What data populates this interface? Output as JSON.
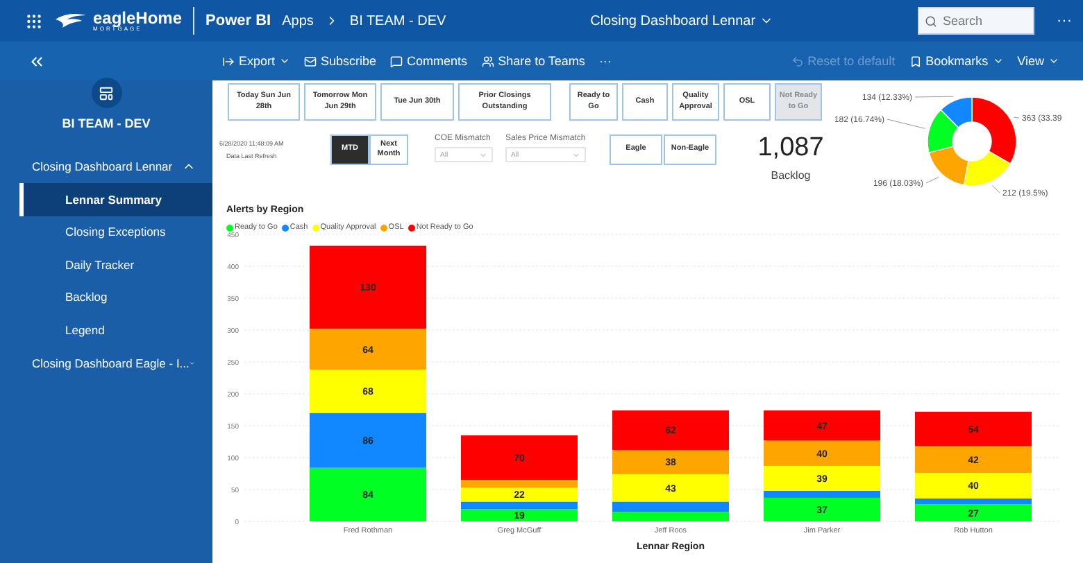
{
  "header": {
    "logo": {
      "name": "eagleHome",
      "tagline": "MORTGAGE"
    },
    "app_name": "Power BI",
    "breadcrumb": [
      "Apps",
      "BI TEAM - DEV"
    ],
    "report_title": "Closing Dashboard Lennar",
    "search": {
      "placeholder": "Search"
    },
    "more": "···"
  },
  "toolbar": {
    "actions": [
      {
        "label": "Export",
        "kind": "menu"
      },
      {
        "label": "Subscribe",
        "kind": "plain"
      },
      {
        "label": "Comments",
        "kind": "plain"
      },
      {
        "label": "Share to Teams",
        "kind": "plain"
      }
    ],
    "more": "···",
    "right": [
      {
        "label": "Reset to default",
        "kind": "plain",
        "disabled": true
      },
      {
        "label": "Bookmarks",
        "kind": "menu",
        "disabled": false
      },
      {
        "label": "View",
        "kind": "menu",
        "disabled": false
      }
    ]
  },
  "sidebar": {
    "workspace": "BI TEAM - DEV",
    "sections": [
      {
        "label": "Closing Dashboard Lennar",
        "expanded": true,
        "children": [
          {
            "label": "Lennar Summary",
            "selected": true
          },
          {
            "label": "Closing Exceptions",
            "selected": false
          },
          {
            "label": "Daily Tracker",
            "selected": false
          },
          {
            "label": "Backlog",
            "selected": false
          },
          {
            "label": "Legend",
            "selected": false
          }
        ]
      },
      {
        "label": "Closing Dashboard Eagle - I...",
        "expanded": false
      }
    ]
  },
  "filters": {
    "date_buttons": [
      {
        "label": "Today Sun Jun 28th",
        "selected": false
      },
      {
        "label": "Tomorrow Mon Jun 29th",
        "selected": false
      },
      {
        "label": "Tue Jun 30th",
        "selected": false
      },
      {
        "label": "Prior Closings Outstanding",
        "selected": false
      }
    ],
    "status_buttons": [
      {
        "label": "Ready to Go",
        "selected": false
      },
      {
        "label": "Cash",
        "selected": false
      },
      {
        "label": "Quality Approval",
        "selected": false
      },
      {
        "label": "OSL",
        "selected": false
      },
      {
        "label": "Not Ready to Go",
        "selected": true
      }
    ],
    "refresh": {
      "timestamp": "6/28/2020 11:48:09 AM",
      "label": "Data Last Refresh"
    },
    "period_buttons": [
      {
        "label": "MTD",
        "selected": true
      },
      {
        "label": "Next Month",
        "selected": false
      }
    ],
    "dropdowns": [
      {
        "label": "COE Mismatch",
        "value": "All"
      },
      {
        "label": "Sales Price Mismatch",
        "value": "All"
      }
    ],
    "lender_buttons": [
      {
        "label": "Eagle",
        "selected": false
      },
      {
        "label": "Non-Eagle",
        "selected": false
      }
    ]
  },
  "backlog": {
    "value": "1,087",
    "label": "Backlog"
  },
  "donut": {
    "chart_data": {
      "type": "donut",
      "values": [
        363,
        212,
        196,
        182,
        134
      ],
      "colors": [
        "#ff0000",
        "#ffff00",
        "#ffa500",
        "#00ff22",
        "#1188ff"
      ],
      "value_labels": [
        "363 (33.39",
        "212 (19.5%)",
        "196 (18.03%)",
        "182 (16.74%)",
        "134 (12.33%)"
      ]
    }
  },
  "chart": {
    "chart_data": {
      "type": "bar",
      "stacked": true,
      "title": "Alerts by Region",
      "xlabel": "Lennar Region",
      "categories": [
        "Fred Rothman",
        "Greg McGuff",
        "Jeff Roos",
        "Jim Parker",
        "Rob Hutton"
      ],
      "ylim": [
        0,
        450
      ],
      "yticks": [
        0,
        50,
        100,
        150,
        200,
        250,
        300,
        350,
        400,
        450
      ],
      "grid": true,
      "value_labels": [
        [
          "84",
          "19",
          null,
          "37",
          "27"
        ],
        [
          "86",
          null,
          null,
          null,
          null
        ],
        [
          "68",
          "22",
          "43",
          "39",
          "40"
        ],
        [
          "64",
          null,
          "38",
          "40",
          "42"
        ],
        [
          "130",
          "70",
          "62",
          "47",
          "54"
        ]
      ],
      "series": [
        {
          "name": "Ready to Go",
          "color": "#00ff22",
          "values": [
            84,
            19,
            15,
            37,
            27
          ]
        },
        {
          "name": "Cash",
          "color": "#1188ff",
          "values": [
            86,
            12,
            16,
            11,
            9
          ]
        },
        {
          "name": "Quality Approval",
          "color": "#ffff00",
          "values": [
            68,
            22,
            43,
            39,
            40
          ]
        },
        {
          "name": "OSL",
          "color": "#ffa500",
          "values": [
            64,
            12,
            38,
            40,
            42
          ]
        },
        {
          "name": "Not Ready to Go",
          "color": "#ff0000",
          "values": [
            130,
            70,
            62,
            47,
            54
          ]
        }
      ]
    }
  }
}
